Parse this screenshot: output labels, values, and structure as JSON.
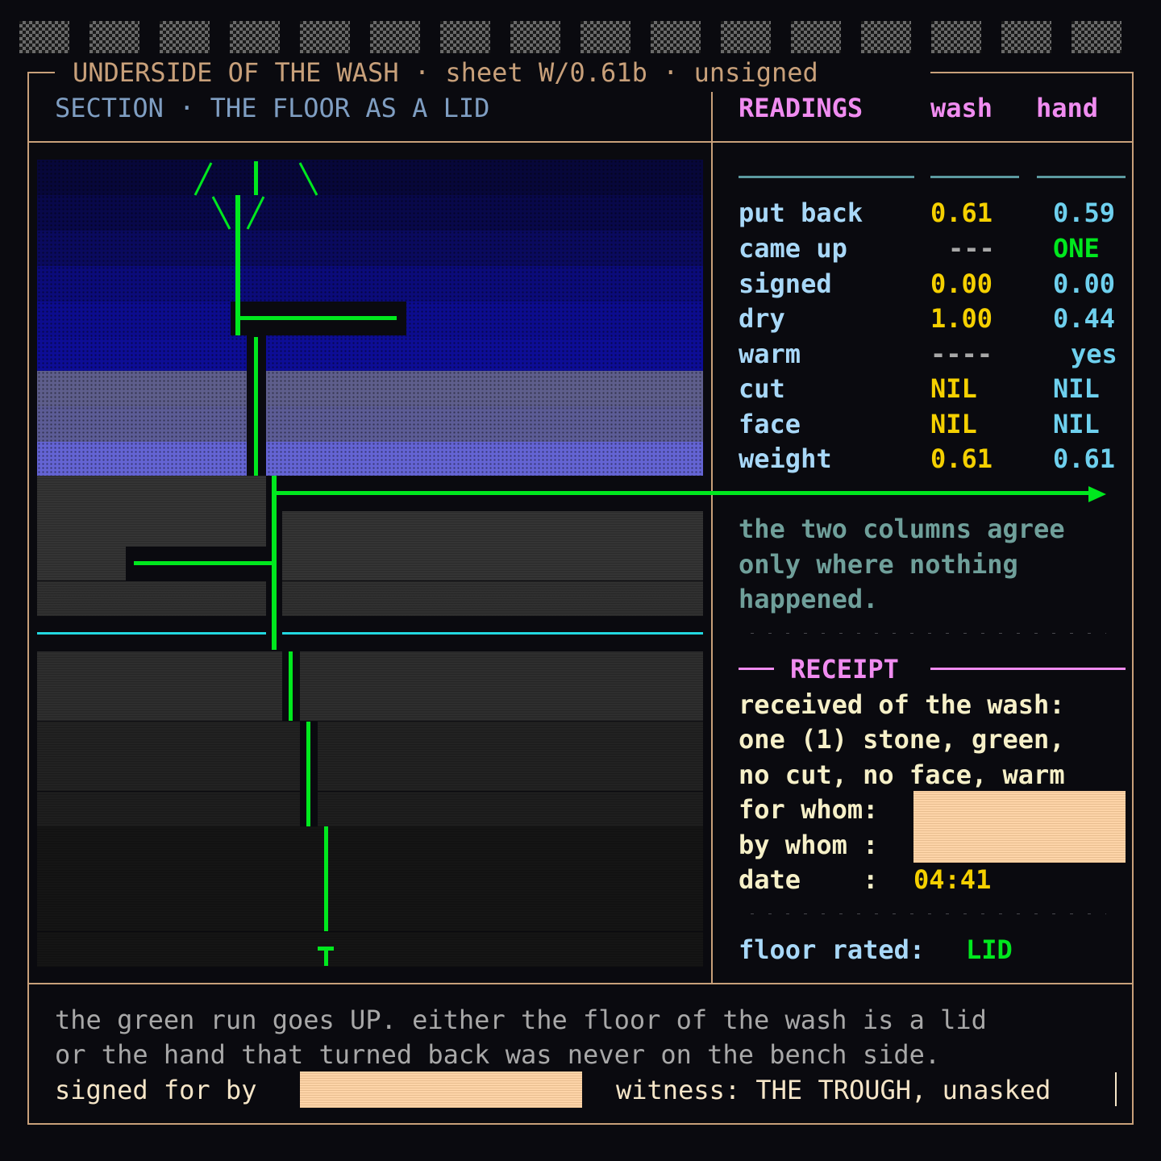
{
  "header": {
    "title": "UNDERSIDE OF THE WASH · sheet W/0.61b · unsigned",
    "section": "SECTION · THE FLOOR AS A LID"
  },
  "readings": {
    "heading": "READINGS",
    "col_wash": "wash",
    "col_hand": "hand",
    "rows": [
      {
        "label": "put back",
        "wash": "0.61",
        "hand": "0.59"
      },
      {
        "label": "came up",
        "wash": "---",
        "hand": "ONE"
      },
      {
        "label": "signed",
        "wash": "0.00",
        "hand": "0.00"
      },
      {
        "label": "dry",
        "wash": "1.00",
        "hand": "0.44"
      },
      {
        "label": "warm",
        "wash": "----",
        "hand": "yes"
      },
      {
        "label": "cut",
        "wash": "NIL",
        "hand": "NIL"
      },
      {
        "label": "face",
        "wash": "NIL",
        "hand": "NIL"
      },
      {
        "label": "weight",
        "wash": "0.61",
        "hand": "0.61"
      }
    ]
  },
  "note": {
    "lines": [
      "the two columns agree",
      "only where nothing",
      "happened."
    ]
  },
  "receipt": {
    "heading": "RECEIPT",
    "lines": [
      "received of the wash:",
      "one (1) stone, green,",
      "no cut, no face, warm"
    ],
    "for_whom_label": "for whom:",
    "by_whom_label": "by whom :",
    "date_label": "date    :",
    "date_value": "04:41",
    "floor_label": "floor rated:",
    "floor_value": "LID"
  },
  "footer": {
    "line1": "the green run goes UP. either the floor of the wash is a lid",
    "line2": "or the hand that turned back was never on the bench side.",
    "signed_label": "signed for by",
    "witness": "witness: THE TROUGH, unasked"
  },
  "colors": {
    "frame": "#c8a07a",
    "green_run": "#00e81e",
    "cyan_rule": "#22d8e0",
    "heading_pink": "#f08cf0",
    "label_blue": "#a8d8f8",
    "wash_yellow": "#f5d000",
    "hand_cyan": "#6ed0ee",
    "note_teal": "#6f9f9a",
    "receipt_cream": "#f6f0c8",
    "redaction": "#fdd4a8"
  }
}
